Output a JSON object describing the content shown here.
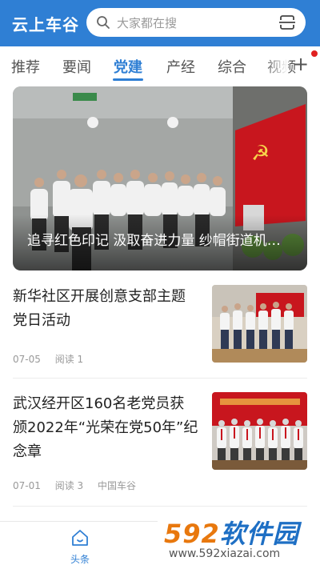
{
  "header": {
    "app_title": "云上车谷",
    "search_placeholder": "大家都在搜"
  },
  "tabs": [
    {
      "label": "推荐",
      "active": false
    },
    {
      "label": "要闻",
      "active": false
    },
    {
      "label": "党建",
      "active": true
    },
    {
      "label": "产经",
      "active": false
    },
    {
      "label": "综合",
      "active": false
    },
    {
      "label": "视频",
      "active": false
    }
  ],
  "more_tabs_symbol": "+",
  "hero": {
    "caption": "追寻红色印记 汲取奋进力量 纱帽街道机…",
    "image_desc_icon": "photo-party-oath"
  },
  "news": [
    {
      "title": "新华社区开展创意支部主题党日活动",
      "date": "07-05",
      "reads": "阅读 1",
      "source": ""
    },
    {
      "title": "武汉经开区160名老党员获颁2022年“光荣在党50年”纪念章",
      "date": "07-01",
      "reads": "阅读 3",
      "source": "中国车谷"
    }
  ],
  "bottom_nav": {
    "home_label": "头条"
  },
  "watermark": {
    "brand_num": "592",
    "brand_cn": "软件园",
    "url": "www.592xiazai.com"
  },
  "colors": {
    "primary": "#2f7fd4",
    "party_red": "#c8161e",
    "badge_red": "#e02020"
  }
}
